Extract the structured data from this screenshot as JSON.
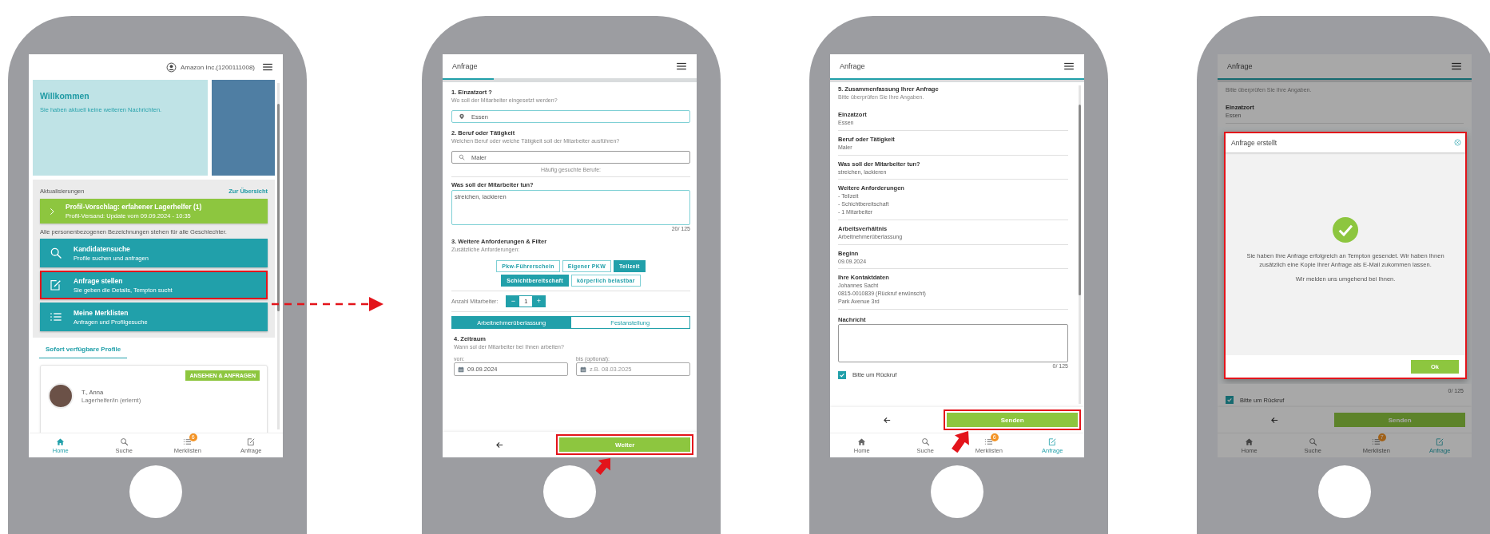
{
  "phones": [
    {
      "kind": "home",
      "account": "Amazon Inc.(1200111008)",
      "welcome": {
        "title": "Willkommen",
        "text": "Sie haben aktuell keine weiteren Nachrichten."
      },
      "updates": {
        "title": "Aktualisierungen",
        "link": "Zur Übersicht",
        "card": {
          "title": "Profil-Vorschlag: erfahener Lagerhelfer (1)",
          "subtitle": "Profil-Versand: Update vom 09.09.2024 - 10:35"
        }
      },
      "note": "Alle personenbezogenen Bezeichnungen stehen für alle Geschlechter.",
      "tiles": [
        {
          "kind": "search",
          "title": "Kandidatensuche",
          "subtitle": "Profile suchen und anfragen",
          "highlighted": false
        },
        {
          "kind": "edit",
          "title": "Anfrage stellen",
          "subtitle": "Sie geben die Details, Tempton sucht",
          "highlighted": true
        },
        {
          "kind": "list",
          "title": "Meine Merklisten",
          "subtitle": "Anfragen und Profilgesuche",
          "highlighted": false
        }
      ],
      "tabs": [
        {
          "label": "Sofort verfügbare Profile",
          "selected": true
        }
      ],
      "profiles": [
        {
          "name": "T., Anna",
          "role": "Lagerhelfer/in (erlernt)",
          "action": "ANSEHEN & ANFRAGEN"
        }
      ],
      "nav": [
        {
          "kind": "home",
          "label": "Home",
          "selected": true
        },
        {
          "kind": "search",
          "label": "Suche",
          "selected": false
        },
        {
          "kind": "list",
          "label": "Merklisten",
          "selected": false,
          "badge": "6"
        },
        {
          "kind": "edit",
          "label": "Anfrage",
          "selected": false
        }
      ]
    },
    {
      "kind": "form",
      "title": "Anfrage",
      "progress": {
        "level": 0.2
      },
      "location": {
        "heading": "1. Einzatzort ?",
        "hint": "Wo soll der Mitarbeiter eingesetzt werden?",
        "value": "Essen",
        "focused": true
      },
      "occupation": {
        "heading": "2. Beruf oder Tätigkeit",
        "hint": "Welchen Beruf oder welche Tätigkeit soll der Mitarbeiter ausführen?",
        "value": "Maler",
        "focused": false,
        "suggestions_label": "Häufig gesuchte Berufe:"
      },
      "task": {
        "label": "Was soll der Mitarbeiter tun?",
        "value": "streichen, lackieren",
        "counter": "20/ 125"
      },
      "requirements": {
        "heading": "3. Weitere Anforderungen & Filter",
        "hint": "Zusätzliche Anforderungen:",
        "chips": [
          {
            "label": "Pkw-Führerschein",
            "selected": false
          },
          {
            "label": "Eigener PKW",
            "selected": false
          },
          {
            "label": "Teilzeit",
            "selected": true
          },
          {
            "label": "Schichtbereitschaft",
            "selected": true
          },
          {
            "label": "körperlich belastbar",
            "selected": false
          }
        ]
      },
      "staff_count": {
        "label": "Anzahl Mitarbeiter:",
        "decrement": "−",
        "value": "1",
        "increment": "+"
      },
      "employment_types": [
        {
          "label": "Arbeitnehmerüberlassung",
          "selected": true
        },
        {
          "label": "Festanstellung",
          "selected": false
        }
      ],
      "period": {
        "heading": "4. Zeitraum",
        "hint": "Wann sol der Mitarbeiter bei Ihnen arbeiten?",
        "from": {
          "label": "von:",
          "value": "09.09.2024"
        },
        "to": {
          "label": "bis (optional):",
          "placeholder": "z.B. 08.03.2025"
        }
      },
      "primary": {
        "label": "Weiter",
        "highlighted": true
      }
    },
    {
      "kind": "summary",
      "title": "Anfrage",
      "progress": {
        "level": 1
      },
      "heading": "5. Zusammenfassung Ihrer Anfrage",
      "hint": "Bitte überprüfen Sie Ihre Angaben.",
      "items": [
        {
          "label": "Einzatzort",
          "lines": [
            "Essen"
          ]
        },
        {
          "label": "Beruf oder Tätigkeit",
          "lines": [
            "Maler"
          ]
        },
        {
          "label": "Was soll der Mitarbeiter tun?",
          "lines": [
            "streichen, lackieren"
          ]
        },
        {
          "label": "Weitere Anforderungen",
          "lines": [
            "- Teilzeit",
            "- Schichtbereitschaft",
            "- 1 Mitarbeiter"
          ]
        },
        {
          "label": "Arbeitsverhältnis",
          "lines": [
            "Arbeitnehmerüberlassung"
          ]
        },
        {
          "label": "Beginn",
          "lines": [
            "09.09.2024"
          ]
        },
        {
          "label": "Ihre Kontaktdaten",
          "lines": [
            "Johannes Sacht",
            "0815-0010839 (Rückruf erwünscht)",
            "Park Avenue 3rd"
          ]
        }
      ],
      "message": {
        "label": "Nachricht",
        "counter": "0/ 125"
      },
      "callback": {
        "label": "Bitte um Rückruf",
        "checked": true
      },
      "primary": {
        "label": "Senden",
        "highlighted": true
      },
      "nav": [
        {
          "kind": "home",
          "label": "Home",
          "selected": false
        },
        {
          "kind": "search",
          "label": "Suche",
          "selected": false
        },
        {
          "kind": "list",
          "label": "Merklisten",
          "selected": false,
          "badge": "6"
        },
        {
          "kind": "edit",
          "label": "Anfrage",
          "selected": true
        }
      ]
    },
    {
      "kind": "confirmation",
      "title": "Anfrage",
      "progress": {
        "level": 1
      },
      "hint": "Bitte überprüfen Sie Ihre Angaben.",
      "items": [
        {
          "label": "Einzatzort",
          "lines": [
            "Essen"
          ]
        }
      ],
      "dialog": {
        "title": "Anfrage erstellt",
        "paragraphs": [
          "Sie haben Ihre Anfrage erfolgreich an Tempton gesendet. Wir haben Ihnen zusätzlich eine Kopie Ihrer Anfrage als E-Mail zukommen lassen.",
          "Wir melden uns umgehend bei Ihnen."
        ],
        "button": "Ok",
        "highlighted": true
      },
      "message": {
        "counter": "0/ 125"
      },
      "callback": {
        "label": "Bitte um Rückruf",
        "checked": true
      },
      "primary": {
        "label": "Senden",
        "highlighted": false
      },
      "nav": [
        {
          "kind": "home",
          "label": "Home",
          "selected": false
        },
        {
          "kind": "search",
          "label": "Suche",
          "selected": false
        },
        {
          "kind": "list",
          "label": "Merklisten",
          "selected": false,
          "badge": "7"
        },
        {
          "kind": "edit",
          "label": "Anfrage",
          "selected": true
        }
      ]
    }
  ]
}
